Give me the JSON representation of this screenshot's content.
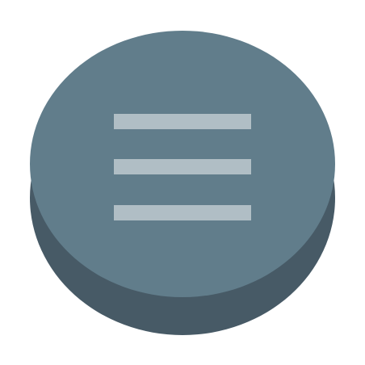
{
  "menu_button": {
    "icon": "hamburger-menu-icon",
    "colors": {
      "face": "#617d8b",
      "side": "#475a66",
      "bars": "#b0bec5",
      "background": "#ffffff"
    },
    "bar_count": 3
  }
}
